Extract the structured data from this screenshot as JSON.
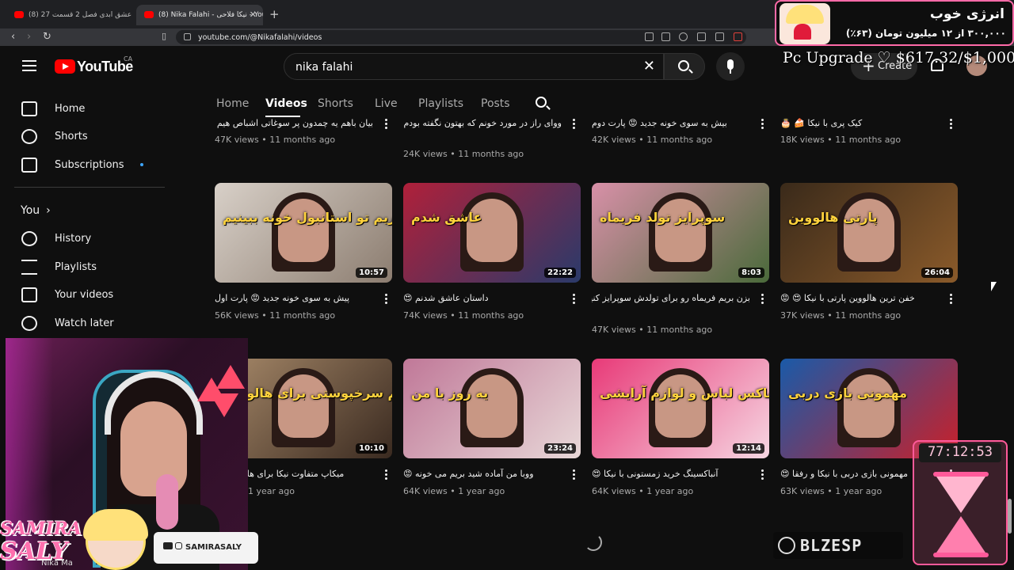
{
  "browser": {
    "tabs": [
      {
        "title": "(8) عشق ابدی فصل 2 قسمت 27 - YouTube",
        "active": false
      },
      {
        "title": "(8) Nika Falahi - نیکا فلاحی - YouTube",
        "active": true
      }
    ],
    "url": "youtube.com/@Nikafalahi/videos"
  },
  "youtube": {
    "logo_text": "YouTube",
    "country": "CA",
    "search": {
      "value": "nika falahi"
    },
    "create_label": "Create"
  },
  "sidebar": {
    "items": [
      {
        "label": "Home",
        "icon": "home-icon"
      },
      {
        "label": "Shorts",
        "icon": "shorts-icon"
      },
      {
        "label": "Subscriptions",
        "icon": "subscriptions-icon"
      }
    ],
    "you_label": "You",
    "you_chevron": "›",
    "you_items": [
      {
        "label": "History",
        "icon": "history-icon"
      },
      {
        "label": "Playlists",
        "icon": "playlists-icon"
      },
      {
        "label": "Your videos",
        "icon": "your-videos-icon"
      },
      {
        "label": "Watch later",
        "icon": "watch-later-icon"
      }
    ]
  },
  "channel_tabs": [
    "Home",
    "Videos",
    "Shorts",
    "Live",
    "Playlists",
    "Posts"
  ],
  "active_tab": "Videos",
  "videos": [
    {
      "title": "بیان باهم یه چمدون پر سوغاتی اشباص هیم 🥰",
      "views": "47K views",
      "age": "11 months ago",
      "row": 0
    },
    {
      "title": "ووای راز در مورد خونم که بهتون نگفته بودم !! 😍",
      "views": "24K views",
      "age": "11 months ago",
      "row": 0
    },
    {
      "title": "بیش به سوی خونه جدید 😡 پارت دوم",
      "views": "42K views",
      "age": "11 months ago",
      "row": 0
    },
    {
      "title": "کیک پری با نیکا 🍰 🎂",
      "views": "18K views",
      "age": "11 months ago",
      "row": 0
    },
    {
      "title": "پیش به سوی خونه جدید 😡 پارت اول",
      "views": "56K views",
      "age": "11 months ago",
      "duration": "10:57",
      "overlay": "بریم تو استانبول خونه ببینیم",
      "colors": [
        "#d8d0c8",
        "#8c7d70"
      ]
    },
    {
      "title": "داستان عاشق شدنم 😍",
      "views": "74K views",
      "age": "11 months ago",
      "duration": "22:22",
      "overlay": "عاشق شدم",
      "colors": [
        "#b0203a",
        "#2a3a6a"
      ]
    },
    {
      "title": "بزن بریم فریماه رو برای تولدش سوپرایز کنیم 😎 😍",
      "views": "47K views",
      "age": "11 months ago",
      "duration": "8:03",
      "overlay": "سوپرایز تولد فریماه",
      "colors": [
        "#d890a8",
        "#4a6a3a"
      ]
    },
    {
      "title": "خفن ترین هالووین پارتی با نیکا 😍 😡",
      "views": "37K views",
      "age": "11 months ago",
      "duration": "26:04",
      "overlay": "پارتی هالووین",
      "colors": [
        "#3a2a1a",
        "#8a5a2a"
      ]
    },
    {
      "title": "میکاپ متفاوت نیکا برای هالووین 😍",
      "views": "",
      "age": "1 year ago",
      "duration": "10:10",
      "overlay": "گریم سرخپوستی برای هالووین",
      "colors": [
        "#a88a6a",
        "#3a2a20"
      ]
    },
    {
      "title": "ووبا من آماده شید بریم می خونه 😡",
      "views": "64K views",
      "age": "1 year ago",
      "duration": "23:24",
      "overlay": "یه روز با من",
      "colors": [
        "#c07898",
        "#e8d8d8"
      ]
    },
    {
      "title": "آنباکسینگ خرید زمستونی با نیکا 😍",
      "views": "64K views",
      "age": "1 year ago",
      "duration": "12:14",
      "overlay": "آنباکس لباس و لوازم آرایشی",
      "colors": [
        "#e83a78",
        "#f6d6e2"
      ]
    },
    {
      "title": "مهمونی بازی دربی با نیکا و رفقا 😍",
      "views": "63K views",
      "age": "1 year ago",
      "overlay": "مهمونی بازی دربی",
      "colors": [
        "#1a5aa8",
        "#c8202a"
      ]
    }
  ],
  "stream": {
    "donation_title": "انرژی خوب",
    "donation_amount": "۳۰۰,۰۰۰ از ۱۲ میلیون تومان (۶۳٪)",
    "goal": "Pc Upgrade ♡ $617.32/$1,000",
    "timer": "77:12:53",
    "streamer_name_line1": "SAMIRA",
    "streamer_name_line2": "SALY",
    "social_handle": "SAMIRASALY",
    "under_brand": "Nika Ma",
    "sponsor": "BLZESP"
  }
}
